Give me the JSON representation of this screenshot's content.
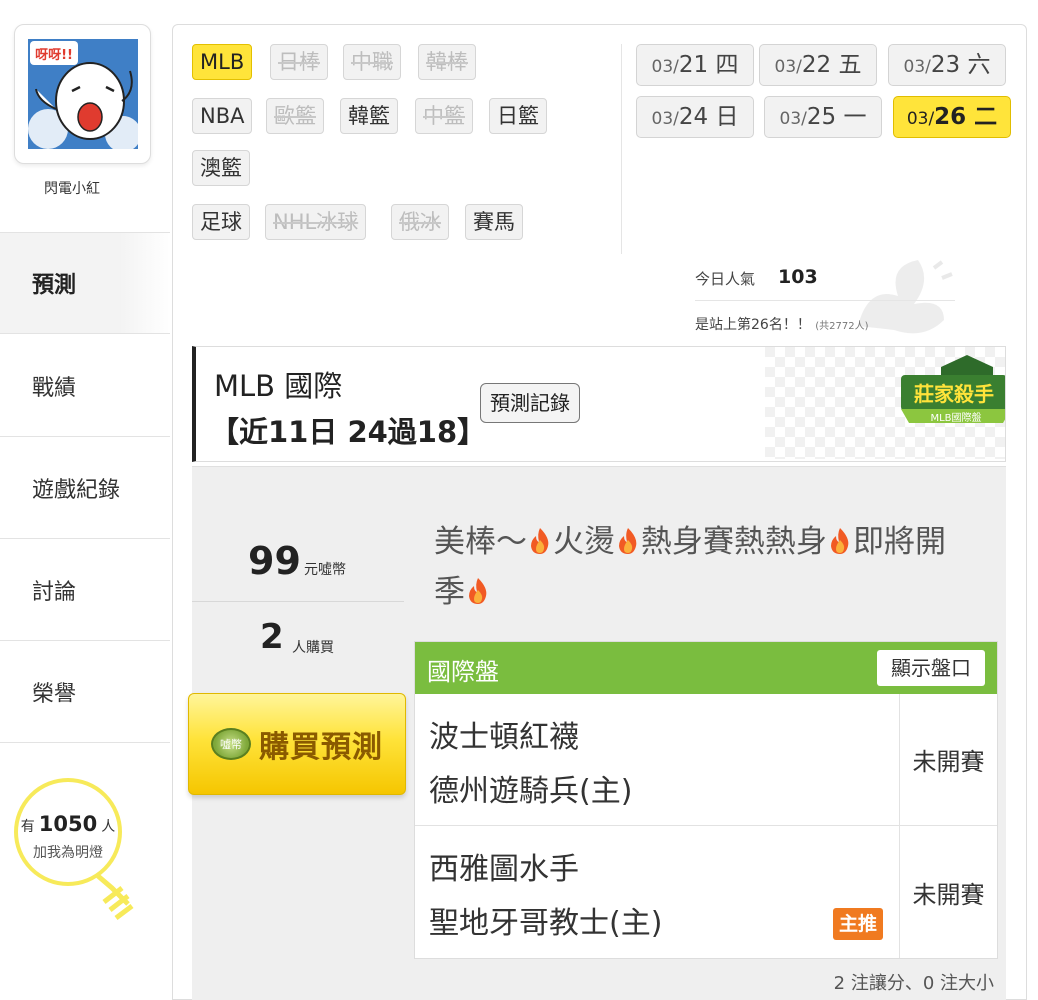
{
  "user": {
    "name": "閃電小紅",
    "avatar_caption": "呀呀!!"
  },
  "nav": [
    {
      "label": "預測",
      "active": true
    },
    {
      "label": "戰績",
      "active": false
    },
    {
      "label": "遊戲紀錄",
      "active": false
    },
    {
      "label": "討論",
      "active": false
    },
    {
      "label": "榮譽",
      "active": false
    }
  ],
  "fans": {
    "prefix": "有",
    "count": "1050",
    "suffix": "人",
    "cta": "加我為明燈"
  },
  "sports": [
    {
      "label": "MLB",
      "selected": true,
      "disabled": false
    },
    {
      "label": "日棒",
      "selected": false,
      "disabled": true
    },
    {
      "label": "中職",
      "selected": false,
      "disabled": true
    },
    {
      "label": "韓棒",
      "selected": false,
      "disabled": true
    },
    {
      "label": "NBA",
      "selected": false,
      "disabled": false
    },
    {
      "label": "歐籃",
      "selected": false,
      "disabled": true
    },
    {
      "label": "韓籃",
      "selected": false,
      "disabled": false
    },
    {
      "label": "中籃",
      "selected": false,
      "disabled": true
    },
    {
      "label": "日籃",
      "selected": false,
      "disabled": false
    },
    {
      "label": "澳籃",
      "selected": false,
      "disabled": false
    },
    {
      "label": "足球",
      "selected": false,
      "disabled": false
    },
    {
      "label": "NHL冰球",
      "selected": false,
      "disabled": true
    },
    {
      "label": "俄冰",
      "selected": false,
      "disabled": true
    },
    {
      "label": "賽馬",
      "selected": false,
      "disabled": false
    }
  ],
  "dates": [
    {
      "month": "03/",
      "day": "21 四",
      "selected": false
    },
    {
      "month": "03/",
      "day": "22 五",
      "selected": false
    },
    {
      "month": "03/",
      "day": "23 六",
      "selected": false
    },
    {
      "month": "03/",
      "day": "24 日",
      "selected": false
    },
    {
      "month": "03/",
      "day": "25 一",
      "selected": false
    },
    {
      "month": "03/",
      "day": "26 二",
      "selected": true
    }
  ],
  "popularity": {
    "label": "今日人氣",
    "value": "103",
    "rank_text": "是站上第26名！！",
    "rank_total": "(共2772人)"
  },
  "card": {
    "title": "MLB 國際",
    "subtitle": "【近11日 24過18】",
    "record_button": "預測記錄",
    "badge_title": "莊家殺手",
    "badge_sub": "MLB國際盤",
    "price": "99",
    "price_unit": "元噓幣",
    "buyers": "2",
    "buyers_unit": "人購買",
    "buy_button": "購買預測",
    "coin_label": "噓幣",
    "headline_parts": [
      "美棒～",
      "火燙",
      "熱身賽熱熱身",
      "即將開季"
    ]
  },
  "odds": {
    "title": "國際盤",
    "toggle": "顯示盤口",
    "games": [
      {
        "away": "波士頓紅襪",
        "home": "德州遊騎兵(主)",
        "status": "未開賽",
        "main_pick": ""
      },
      {
        "away": "西雅圖水手",
        "home": "聖地牙哥教士(主)",
        "status": "未開賽",
        "main_pick": "主推"
      }
    ],
    "summary": "2 注讓分、0 注大小"
  },
  "colors": {
    "accent_yellow": "#ffe43a",
    "green_header": "#7abd3f",
    "orange_badge": "#f07a20"
  }
}
